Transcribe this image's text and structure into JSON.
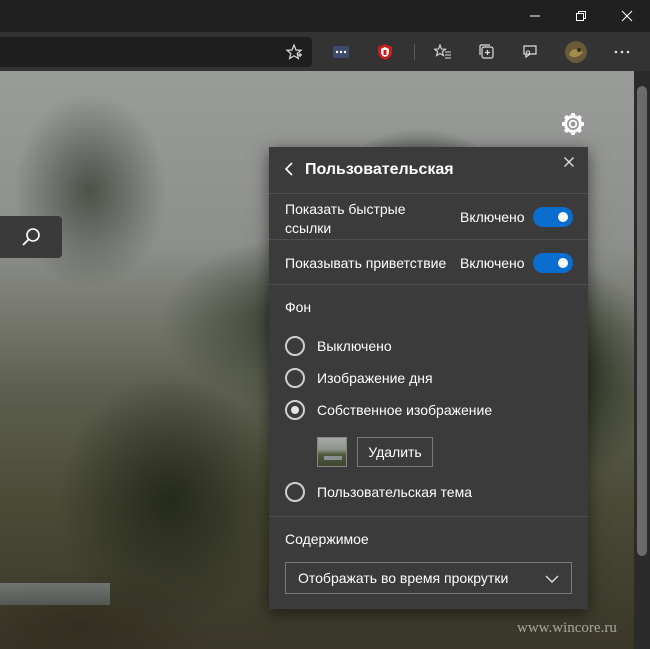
{
  "window": {
    "controls": [
      "minimize-icon",
      "restore-icon",
      "close-icon"
    ]
  },
  "toolbar": {
    "icons": [
      "favorite-star-icon",
      "extension-icon",
      "shield-extension-icon",
      "favorites-list-icon",
      "collections-icon",
      "feedback-icon",
      "profile-avatar",
      "more-menu-icon"
    ]
  },
  "panel": {
    "title": "Пользовательская",
    "quick_links": {
      "label": "Показать быстрые ссылки",
      "state": "Включено",
      "on": true
    },
    "greeting": {
      "label": "Показывать приветствие",
      "state": "Включено",
      "on": true
    },
    "background": {
      "heading": "Фон",
      "options": [
        {
          "label": "Выключено",
          "checked": false
        },
        {
          "label": "Изображение дня",
          "checked": false
        },
        {
          "label": "Собственное изображение",
          "checked": true
        },
        {
          "label": "Пользовательская тема",
          "checked": false
        }
      ],
      "delete_label": "Удалить"
    },
    "content": {
      "heading": "Содержимое",
      "selected": "Отображать во время прокрутки"
    }
  },
  "watermark": "www.wincore.ru",
  "colors": {
    "toggle_on": "#0a6ed1",
    "panel_bg": "#3b3b3b",
    "toolbar_bg": "#333333"
  }
}
